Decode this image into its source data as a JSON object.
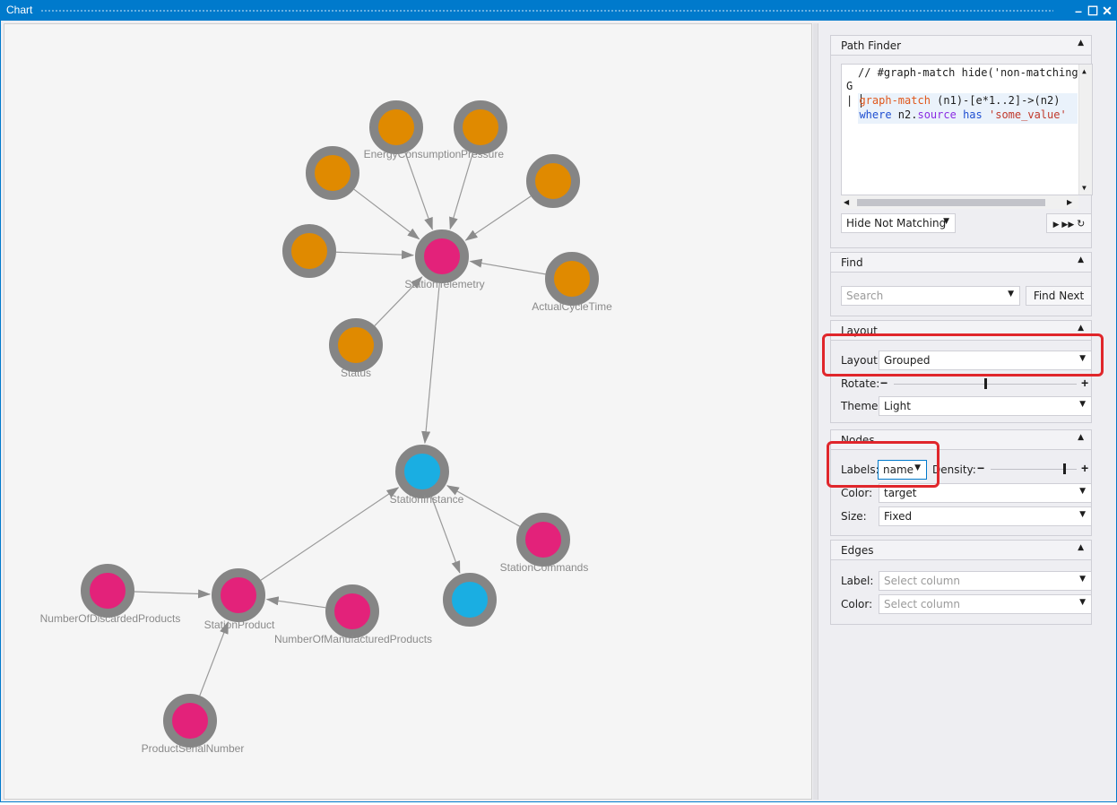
{
  "window": {
    "title": "Chart"
  },
  "colors": {
    "accent": "#007acc",
    "orange": "#e08a00",
    "magenta": "#e3227a",
    "cyan": "#1aaee2",
    "ring": "#858585",
    "highlight": "#e0262b"
  },
  "path_finder": {
    "header": "Path Finder",
    "code": [
      "// #graph-match hide('non-matching",
      "G",
      "| graph-match (n1)-[e*1..2]->(n2)",
      "  where n2.source has 'some_value'"
    ],
    "mode": "Hide Not Matching"
  },
  "find": {
    "header": "Find",
    "placeholder": "Search",
    "button": "Find Next"
  },
  "layout": {
    "header": "Layout",
    "layout_label": "Layout:",
    "layout_value": "Grouped",
    "rotate_label": "Rotate:",
    "rotate_level": 0.5,
    "theme_label": "Theme:",
    "theme_value": "Light"
  },
  "nodes": {
    "header": "Nodes",
    "labels_label": "Labels:",
    "labels_value": "name",
    "density_label": "Density:",
    "density_level": 0.85,
    "color_label": "Color:",
    "color_value": "target",
    "size_label": "Size:",
    "size_value": "Fixed"
  },
  "edges": {
    "header": "Edges",
    "label_label": "Label:",
    "label_placeholder": "Select column",
    "color_label": "Color:",
    "color_placeholder": "Select column"
  },
  "graph": {
    "nodes": [
      {
        "id": "n_ec",
        "label": "EnergyConsumption",
        "color": "orange"
      },
      {
        "id": "n_pr",
        "label": "Pressure",
        "color": "orange"
      },
      {
        "id": "n_o1",
        "label": "",
        "color": "orange"
      },
      {
        "id": "n_o2",
        "label": "",
        "color": "orange"
      },
      {
        "id": "n_o3",
        "label": "",
        "color": "orange"
      },
      {
        "id": "n_act",
        "label": "ActualCycleTime",
        "color": "orange"
      },
      {
        "id": "n_st",
        "label": "Status",
        "color": "orange"
      },
      {
        "id": "n_tel",
        "label": "StationTelemetry",
        "color": "magenta"
      },
      {
        "id": "n_inst",
        "label": "StationInstance",
        "color": "cyan"
      },
      {
        "id": "n_cmd",
        "label": "StationCommands",
        "color": "magenta"
      },
      {
        "id": "n_c2",
        "label": "",
        "color": "cyan"
      },
      {
        "id": "n_prod",
        "label": "StationProduct",
        "color": "magenta"
      },
      {
        "id": "n_disc",
        "label": "NumberOfDiscardedProducts",
        "color": "magenta"
      },
      {
        "id": "n_man",
        "label": "NumberOfManufacturedProducts",
        "color": "magenta"
      },
      {
        "id": "n_ser",
        "label": "ProductSerialNumber",
        "color": "magenta"
      }
    ],
    "edges": [
      {
        "from": "n_ec",
        "to": "n_tel"
      },
      {
        "from": "n_pr",
        "to": "n_tel"
      },
      {
        "from": "n_o1",
        "to": "n_tel"
      },
      {
        "from": "n_o2",
        "to": "n_tel"
      },
      {
        "from": "n_o3",
        "to": "n_tel"
      },
      {
        "from": "n_act",
        "to": "n_tel"
      },
      {
        "from": "n_st",
        "to": "n_tel"
      },
      {
        "from": "n_tel",
        "to": "n_inst"
      },
      {
        "from": "n_cmd",
        "to": "n_inst"
      },
      {
        "from": "n_inst",
        "to": "n_c2"
      },
      {
        "from": "n_prod",
        "to": "n_inst"
      },
      {
        "from": "n_disc",
        "to": "n_prod"
      },
      {
        "from": "n_man",
        "to": "n_prod"
      },
      {
        "from": "n_ser",
        "to": "n_prod"
      }
    ]
  }
}
